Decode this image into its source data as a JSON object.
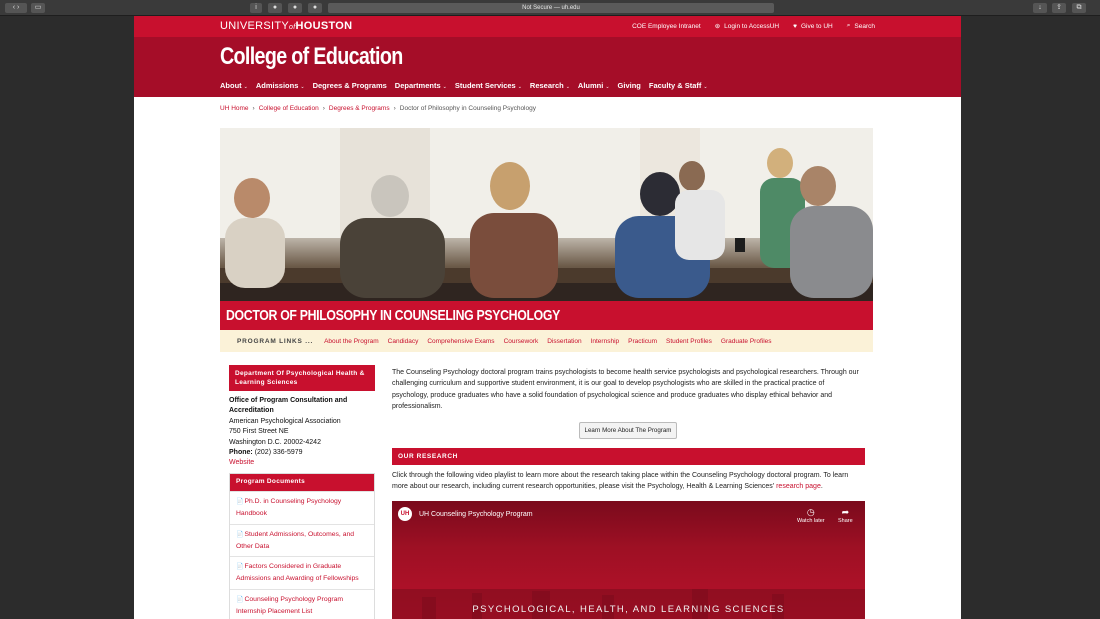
{
  "browser": {
    "address": "Not Secure — uh.edu"
  },
  "topbar": {
    "logo_main": "UNIVERSITY",
    "logo_of": "of",
    "logo_houston": "HOUSTON",
    "links": [
      {
        "label": "COE Employee Intranet"
      },
      {
        "label": "Login to AccessUH"
      },
      {
        "label": "Give to UH"
      },
      {
        "label": "Search"
      }
    ]
  },
  "header": {
    "college": "College of Education",
    "nav": [
      {
        "label": "About",
        "caret": true
      },
      {
        "label": "Admissions",
        "caret": true
      },
      {
        "label": "Degrees & Programs",
        "caret": false
      },
      {
        "label": "Departments",
        "caret": true
      },
      {
        "label": "Student Services",
        "caret": true
      },
      {
        "label": "Research",
        "caret": true
      },
      {
        "label": "Alumni",
        "caret": true
      },
      {
        "label": "Giving",
        "caret": false
      },
      {
        "label": "Faculty & Staff",
        "caret": true
      }
    ]
  },
  "breadcrumb": {
    "items": [
      "UH Home",
      "College of Education",
      "Degrees & Programs"
    ],
    "current": "Doctor of Philosophy in Counseling Psychology"
  },
  "page_title": "DOCTOR OF PHILOSOPHY IN COUNSELING PSYCHOLOGY",
  "program_links": {
    "label": "PROGRAM LINKS ...",
    "items": [
      "About the Program",
      "Candidacy",
      "Comprehensive Exams",
      "Coursework",
      "Dissertation",
      "Internship",
      "Practicum",
      "Student Profiles",
      "Graduate Profiles"
    ]
  },
  "sidebar": {
    "dept_title": "Department Of Psychological Health & Learning Sciences",
    "contact": {
      "office": "Office of Program Consultation and Accreditation",
      "org": "American Psychological Association",
      "street": "750 First Street NE",
      "city": "Washington D.C. 20002-4242",
      "phone_label": "Phone:",
      "phone": "(202) 336-5979",
      "website": "Website"
    },
    "docs_title": "Program Documents",
    "docs": [
      "Ph.D. in Counseling Psychology Handbook",
      "Student Admissions, Outcomes, and Other Data",
      "Factors Considered in Graduate Admissions and Awarding of Fellowships",
      "Counseling Psychology Program Internship Placement List"
    ]
  },
  "main": {
    "intro": "The Counseling Psychology doctoral program trains psychologists to become health service psychologists and psychological researchers. Through our challenging curriculum and supportive student environment, it is our goal to develop psychologists who are skilled in the practical practice of psychology, produce graduates who have a solid foundation of psychological science and produce graduates who display ethical behavior and professionalism.",
    "learn_button": "Learn More About The Program",
    "research_heading": "OUR RESEARCH",
    "research_text": "Click through the following video playlist to learn more about the research taking place within the Counseling Psychology doctoral program. To learn more about our research, including current research opportunities, please visit the Psychology, Health & Learning Sciences'",
    "research_link": "research page",
    "research_end": ".",
    "video": {
      "title": "UH Counseling Psychology Program",
      "watch_later": "Watch later",
      "share": "Share",
      "overlay": "PSYCHOLOGICAL, HEALTH, AND LEARNING SCIENCES"
    }
  },
  "colors": {
    "brand": "#c8102e",
    "header": "#a50d28",
    "program_bar": "#fbf2d8"
  }
}
